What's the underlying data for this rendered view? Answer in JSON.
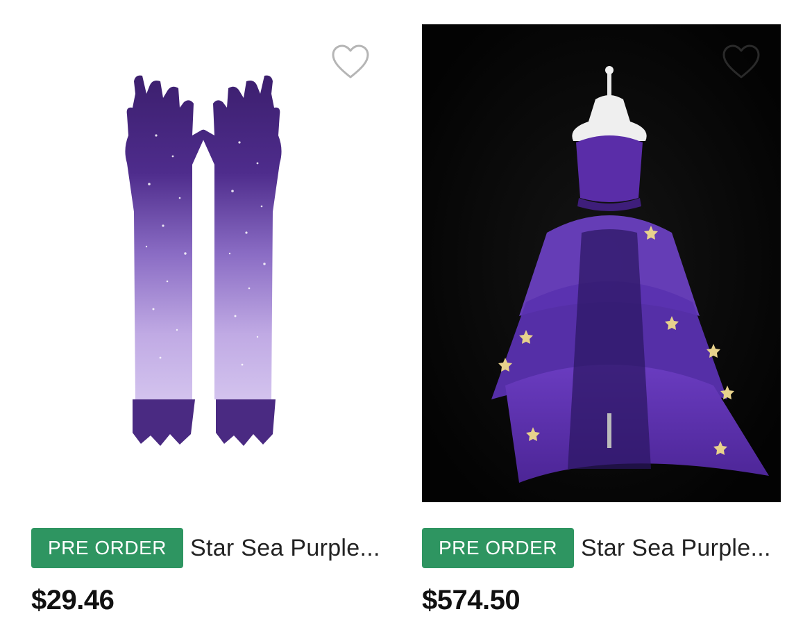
{
  "products": [
    {
      "badge": "PRE ORDER",
      "title": "Star Sea Purple...",
      "price": "$29.46",
      "image": "purple starry long gloves",
      "favorite_icon": "heart-outline-icon",
      "favorite_icon_color": "#b5b5b5"
    },
    {
      "badge": "PRE ORDER",
      "title": "Star Sea Purple...",
      "price": "$574.50",
      "image": "purple starry tulle gown on mannequin",
      "favorite_icon": "heart-outline-icon",
      "favorite_icon_color": "#2a2a2a"
    }
  ],
  "colors": {
    "badge_background": "#2e9561",
    "badge_text": "#ffffff",
    "price_text": "#111111"
  }
}
